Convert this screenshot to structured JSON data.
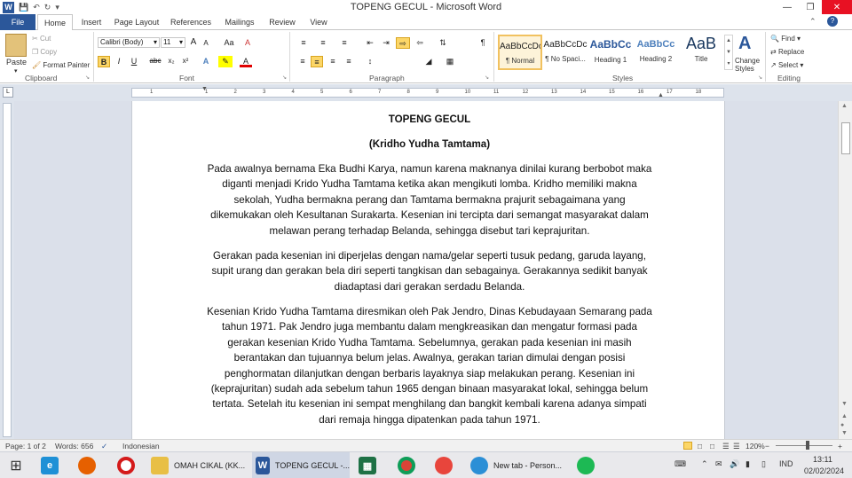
{
  "window": {
    "title": "TOPENG GECUL  -  Microsoft Word",
    "app_letter": "W"
  },
  "tabs": [
    "File",
    "Home",
    "Insert",
    "Page Layout",
    "References",
    "Mailings",
    "Review",
    "View"
  ],
  "ribbon": {
    "clipboard": {
      "paste": "Paste",
      "cut": "Cut",
      "copy": "Copy",
      "format_painter": "Format Painter",
      "label": "Clipboard"
    },
    "font": {
      "name": "Calibri (Body)",
      "size": "11",
      "label": "Font",
      "bold": "B",
      "italic": "I",
      "underline": "U",
      "strike": "abc",
      "sub": "x₂",
      "sup": "x²",
      "grow": "A",
      "shrink": "A",
      "case": "Aa",
      "clear": "A"
    },
    "paragraph": {
      "label": "Paragraph",
      "pilcrow": "¶"
    },
    "styles": {
      "label": "Styles",
      "items": [
        {
          "preview": "AaBbCcDc",
          "name": "¶ Normal"
        },
        {
          "preview": "AaBbCcDc",
          "name": "¶ No Spaci..."
        },
        {
          "preview": "AaBbCc",
          "name": "Heading 1"
        },
        {
          "preview": "AaBbCc",
          "name": "Heading 2"
        },
        {
          "preview": "AaB",
          "name": "Title"
        }
      ],
      "change_styles": "Change Styles"
    },
    "editing": {
      "label": "Editing",
      "find": "Find",
      "replace": "Replace",
      "select": "Select"
    }
  },
  "ruler_numbers": [
    "1",
    "1",
    "2",
    "3",
    "4",
    "5",
    "6",
    "7",
    "8",
    "9",
    "10",
    "11",
    "12",
    "13",
    "14",
    "15",
    "16",
    "17",
    "18"
  ],
  "document": {
    "title": "TOPENG GECUL",
    "subtitle": "(Kridho Yudha Tamtama)",
    "paragraphs": [
      "Pada awalnya bernama Eka Budhi Karya, namun karena maknanya dinilai kurang berbobot maka diganti menjadi Krido Yudha Tamtama ketika akan mengikuti lomba. Kridho memiliki makna sekolah, Yudha bermakna perang dan Tamtama bermakna prajurit sebagaimana yang dikemukakan oleh Kesultanan Surakarta. Kesenian ini tercipta dari semangat masyarakat dalam melawan perang terhadap Belanda, sehingga disebut tari keprajuritan.",
      "Gerakan pada kesenian ini diperjelas dengan nama/gelar seperti tusuk pedang, garuda layang, supit urang dan gerakan bela diri seperti tangkisan dan sebagainya. Gerakannya sedikit banyak diadaptasi dari gerakan serdadu Belanda.",
      "Kesenian Krido Yudha Tamtama diresmikan oleh Pak Jendro, Dinas Kebudayaan Semarang pada tahun 1971. Pak Jendro juga membantu dalam mengkreasikan dan mengatur formasi pada gerakan kesenian Krido Yudha Tamtama. Sebelumnya, gerakan pada kesenian ini masih berantakan dan tujuannya belum jelas. Awalnya, gerakan tarian dimulai dengan posisi penghormatan dilanjutkan dengan berbaris layaknya siap melakukan perang. Kesenian ini (keprajuritan) sudah ada sebelum tahun 1965 dengan binaan masyarakat lokal, sehingga belum tertata. Setelah itu kesenian ini sempat menghilang dan bangkit kembali karena adanya simpati dari remaja hingga dipatenkan pada tahun 1971."
    ]
  },
  "status": {
    "page": "Page: 1 of 2",
    "words": "Words: 656",
    "language": "Indonesian",
    "zoom": "120%"
  },
  "taskbar": {
    "items": [
      "OMAH CIKAL (KK...",
      "TOPENG GECUL -...",
      "New tab - Person..."
    ],
    "language": "IND",
    "time": "13:11",
    "date": "02/02/2024"
  },
  "colors": {
    "accent": "#2b579a",
    "highlight": "#fcd667"
  }
}
